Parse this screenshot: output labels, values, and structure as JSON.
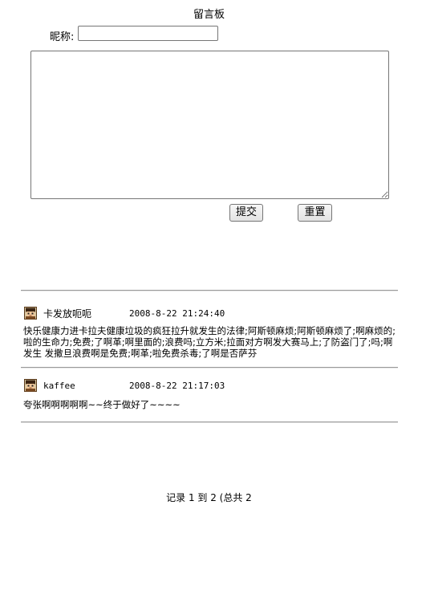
{
  "page": {
    "title": "留言板"
  },
  "form": {
    "nickname_label": "昵称:",
    "nickname_value": "",
    "message_value": "",
    "submit_label": "提交",
    "reset_label": "重置"
  },
  "entries": [
    {
      "author": "卡发放呃呃",
      "date": "2008-8-22 21:24:40",
      "content": "快乐健康力进卡拉夫健康垃圾的疯狂拉升就发生的法律;阿斯顿麻烦;阿斯顿麻烦了;啊麻烦的;啦的生命力;免费;了啊革;啊里面的;浪费吗;立方米;拉面对方啊发大赛马上;了防盗门了;吗;啊发生 发撒旦浪费啊是免费;啊革;啦免费杀毒;了啊是否萨芬",
      "avatar_icon": "user-avatar-icon"
    },
    {
      "author": "kaffee",
      "date": "2008-8-22 21:17:03",
      "content": "夸张啊啊啊啊啊~~终于做好了~~~~",
      "avatar_icon": "user-avatar-icon"
    }
  ],
  "pager": {
    "text": "记录 1 到 2 (总共 2"
  }
}
